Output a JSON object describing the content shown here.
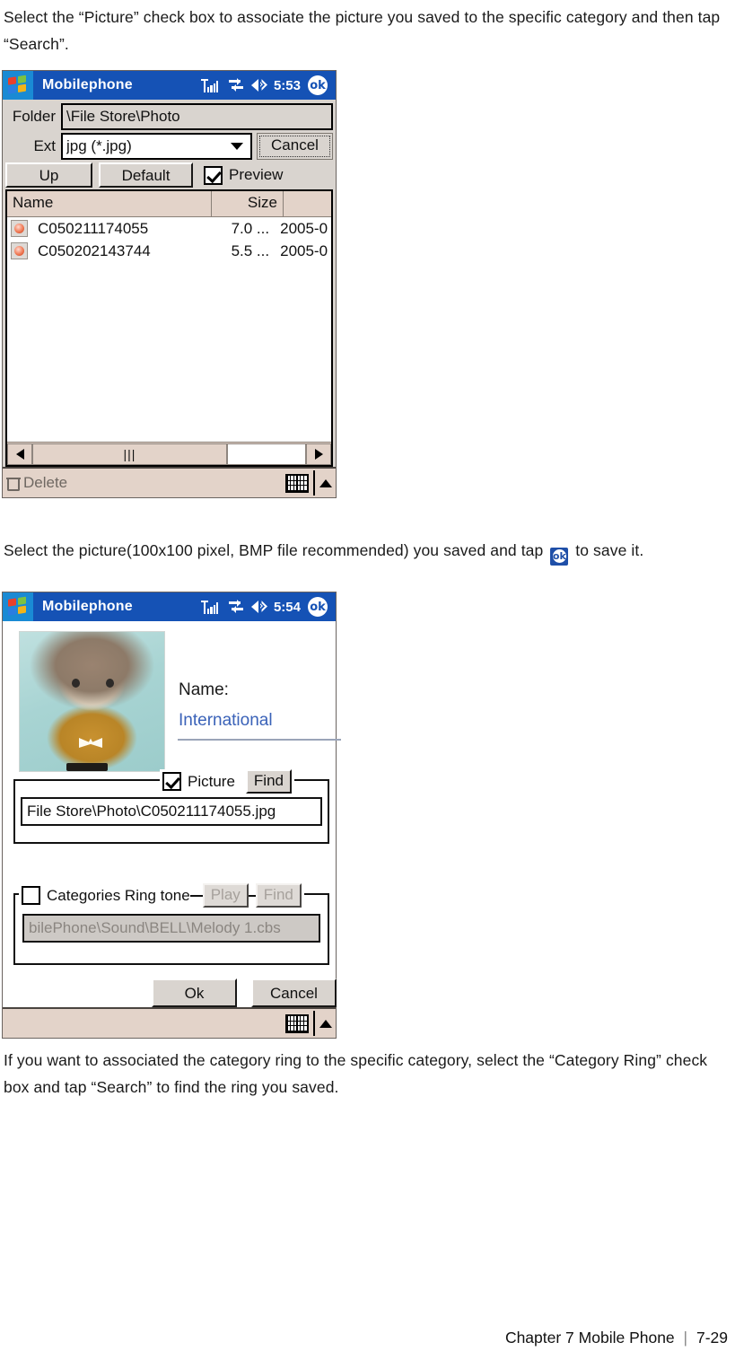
{
  "page": {
    "paragraph_1": "Select the “Picture” check box to associate the picture you saved to the specific category and then tap “Search”.",
    "paragraph_2_before": "Select the picture(100x100 pixel, BMP file recommended) you saved and tap",
    "paragraph_2_after": "to save it.",
    "inline_ok_badge": "ok",
    "paragraph_3": "If you want to associated the category ring to the specific category, select the “Category Ring” check box and tap “Search” to find the ring you saved."
  },
  "footer": {
    "chapter": "Chapter 7 Mobile Phone",
    "separator": "|",
    "page_number": "7-29"
  },
  "file_browser": {
    "titlebar": {
      "app_title": "Mobilephone",
      "clock": "5:53",
      "ok_label": "ok",
      "icons": [
        "signal-icon",
        "connectivity-icon",
        "volume-icon"
      ]
    },
    "folder_label": "Folder",
    "folder_value": "\\File Store\\Photo",
    "ext_label": "Ext",
    "ext_value": "jpg (*.jpg)",
    "cancel_label": "Cancel",
    "up_label": "Up",
    "default_label": "Default",
    "preview_label": "Preview",
    "preview_checked": true,
    "columns": [
      "Name",
      "Size",
      ""
    ],
    "rows": [
      {
        "name": "C050211174055",
        "size": "7.0 ...",
        "date": "2005-0"
      },
      {
        "name": "C050202143744",
        "size": "5.5 ...",
        "date": "2005-0"
      }
    ],
    "scroll_thumb_glyph": "|||",
    "delete_label": "Delete"
  },
  "category_editor": {
    "titlebar": {
      "app_title": "Mobilephone",
      "clock": "5:54",
      "ok_label": "ok"
    },
    "name_label": "Name:",
    "name_value": "International",
    "picture_group": {
      "checkbox_label": "Picture",
      "checked": true,
      "find_label": "Find",
      "path_value": "File Store\\Photo\\C050211174055.jpg"
    },
    "ringtone_group": {
      "checkbox_label": "Categories Ring tone",
      "checked": false,
      "play_label": "Play",
      "find_label": "Find",
      "path_value": "bilePhone\\Sound\\BELL\\Melody 1.cbs",
      "disabled": true
    },
    "ok_label": "Ok",
    "cancel_label": "Cancel"
  },
  "colors": {
    "titlebar_blue": "#1552b5",
    "taskbar_beige": "#e3d3c9",
    "dialog_gray": "#d9d4cf",
    "link_blue": "#3a62b8"
  }
}
